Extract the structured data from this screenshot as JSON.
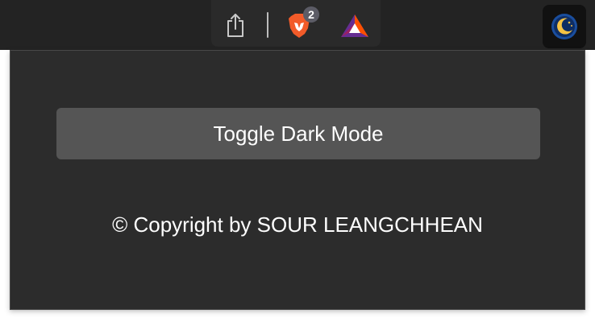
{
  "toolbar": {
    "share_icon": "share-icon",
    "brave_shields_icon": "brave-lion-icon",
    "brave_badge_count": "2",
    "bat_rewards_icon": "bat-triangle-icon",
    "extension_icon": "moon-dark-mode-icon"
  },
  "popup": {
    "toggle_label": "Toggle Dark Mode",
    "copyright_text": "© Copyright by SOUR LEANGCHHEAN"
  },
  "colors": {
    "toolbar_bg": "#232323",
    "popup_bg": "#2c2c2c",
    "button_bg": "#555555",
    "text": "#ffffff",
    "brave_orange": "#f25b29",
    "badge_bg": "#5c5c66"
  }
}
